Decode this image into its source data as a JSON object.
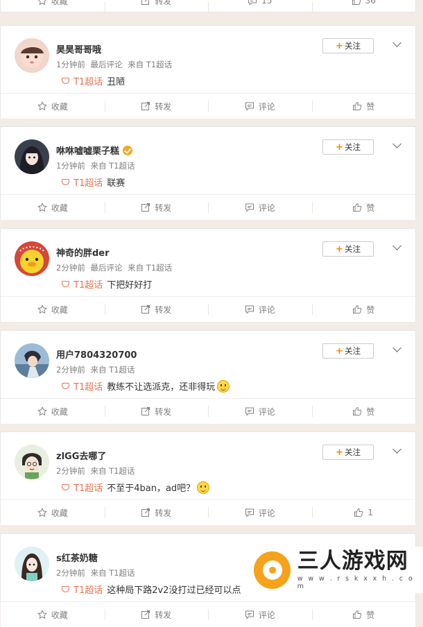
{
  "topbar": {
    "favorite_label": "收藏",
    "repost_label": "转发",
    "comment_label": "15",
    "like_label": "36"
  },
  "posts": [
    {
      "name": "昊昊哥哥哦",
      "verified": false,
      "time": "1分钟前",
      "source": "最后评论",
      "from": "来自 T1超话",
      "topic": "T1超话",
      "text": "丑陋",
      "emoji": "",
      "follow_label": "关注",
      "favorite_label": "收藏",
      "repost_label": "转发",
      "comment_label": "评论",
      "like_label": "赞",
      "avatar": "baby-photo"
    },
    {
      "name": "咻咻嘘嘘栗子糕",
      "verified": true,
      "time": "1分钟前",
      "source": "",
      "from": "来自 T1超话",
      "topic": "T1超话",
      "text": "联赛",
      "emoji": "",
      "follow_label": "关注",
      "favorite_label": "收藏",
      "repost_label": "转发",
      "comment_label": "评论",
      "like_label": "赞",
      "avatar": "anime-girl"
    },
    {
      "name": "神奇的胖der",
      "verified": false,
      "time": "2分钟前",
      "source": "最后评论",
      "from": "来自 T1超话",
      "topic": "T1超话",
      "text": "下把好好打",
      "emoji": "",
      "follow_label": "关注",
      "favorite_label": "收藏",
      "repost_label": "转发",
      "comment_label": "评论",
      "like_label": "赞",
      "avatar": "yellow-chick"
    },
    {
      "name": "用户7804320700",
      "verified": false,
      "time": "2分钟前",
      "source": "",
      "from": "来自 T1超话",
      "topic": "T1超话",
      "text": "教练不让选派克，还非得玩",
      "emoji": "laugh",
      "follow_label": "关注",
      "favorite_label": "收藏",
      "repost_label": "转发",
      "comment_label": "评论",
      "like_label": "赞",
      "avatar": "anime-boy"
    },
    {
      "name": "zlGG去哪了",
      "verified": false,
      "time": "2分钟前",
      "source": "",
      "from": "来自 T1超话",
      "topic": "T1超话",
      "text": "不至于4ban，ad吧？",
      "emoji": "smile",
      "follow_label": "关注",
      "favorite_label": "收藏",
      "repost_label": "转发",
      "comment_label": "评论",
      "like_label": "1",
      "avatar": "cartoon-face"
    },
    {
      "name": "s红茶奶糖",
      "verified": false,
      "time": "2分钟前",
      "source": "",
      "from": "来自 T1超话",
      "topic": "T1超话",
      "text": "这种局下路2v2没打过已经可以点",
      "emoji": "",
      "follow_label": "关注",
      "favorite_label": "收藏",
      "repost_label": "转发",
      "comment_label": "评论",
      "like_label": "赞",
      "avatar": "anime-girl-2"
    }
  ],
  "watermark": {
    "title": "三人游戏网",
    "url": "w w w . r s k x x h . c o m"
  },
  "colors": {
    "accent": "#ff8200",
    "topic": "#eb7350",
    "background": "#f2ebe6"
  }
}
